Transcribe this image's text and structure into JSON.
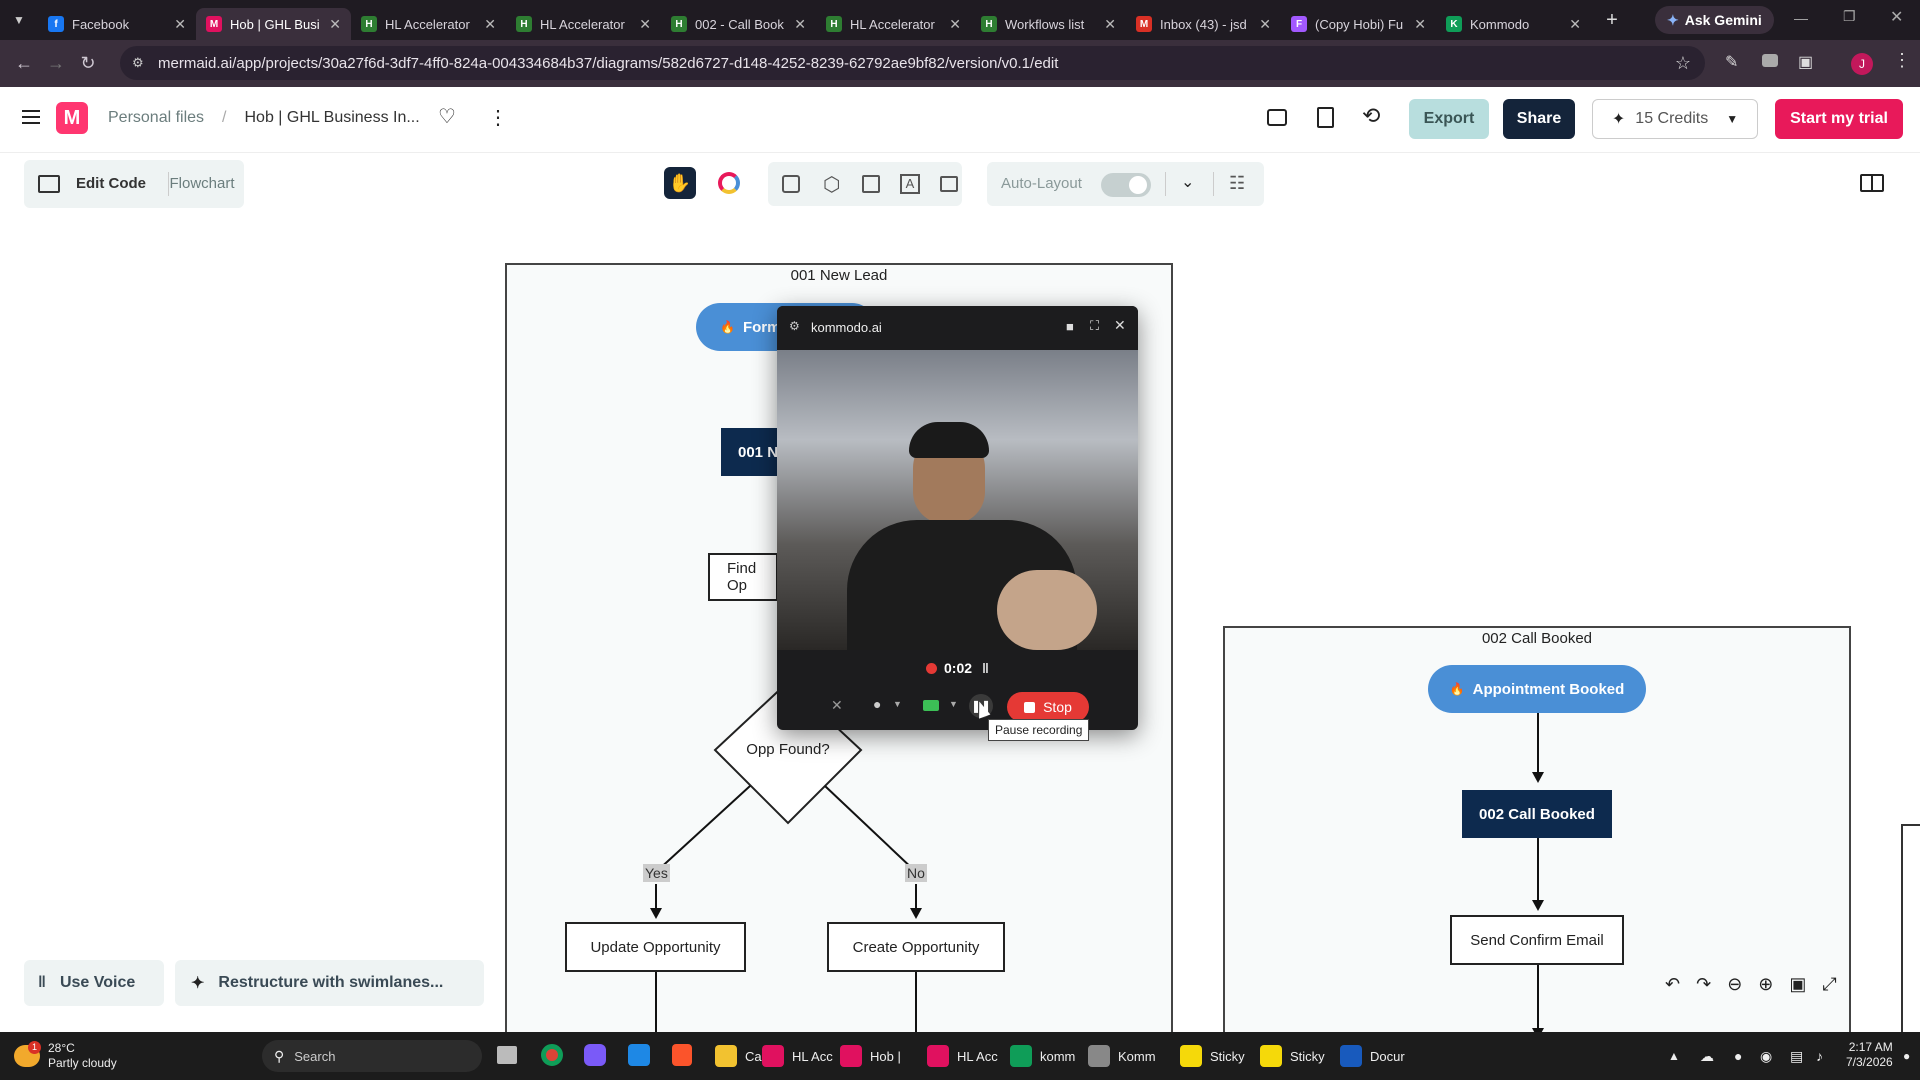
{
  "browser": {
    "tabs": [
      {
        "title": "Facebook",
        "color": "#1877f2",
        "glyph": "f"
      },
      {
        "title": "Hob | GHL Busi",
        "color": "#e0115f",
        "glyph": "M",
        "active": true
      },
      {
        "title": "HL Accelerator",
        "color": "#2e7d32",
        "glyph": "H"
      },
      {
        "title": "HL Accelerator",
        "color": "#2e7d32",
        "glyph": "H"
      },
      {
        "title": "002 - Call Book",
        "color": "#2e7d32",
        "glyph": "H"
      },
      {
        "title": "HL Accelerator",
        "color": "#2e7d32",
        "glyph": "H"
      },
      {
        "title": "Workflows list",
        "color": "#2e7d32",
        "glyph": "H"
      },
      {
        "title": "Inbox (43) - jsd",
        "color": "#d93025",
        "glyph": "M"
      },
      {
        "title": "(Copy Hobi) Fu",
        "color": "#a259ff",
        "glyph": "F"
      },
      {
        "title": "Kommodo",
        "color": "#0f9d58",
        "glyph": "K"
      }
    ],
    "new_tab": "+",
    "gemini": "Ask Gemini",
    "url": "mermaid.ai/app/projects/30a27f6d-3df7-4ff0-824a-004334684b37/diagrams/582d6727-d148-4252-8239-62792ae9bf82/version/v0.1/edit",
    "profile_initial": "J"
  },
  "app": {
    "breadcrumb_root": "Personal files",
    "breadcrumb_sep": "/",
    "doc_title": "Hob | GHL Business In...",
    "export": "Export",
    "share": "Share",
    "credits": "15 Credits",
    "trial": "Start my trial",
    "edit_code": "Edit Code",
    "flowchart": "Flowchart",
    "auto_layout": "Auto-Layout",
    "auto_layout_on": false,
    "use_voice": "Use Voice",
    "restructure": "Restructure with swimlanes..."
  },
  "diagram": {
    "frame1": {
      "title": "001 New Lead",
      "trigger": "Form",
      "stage": "001 N",
      "find": "Find Op",
      "decision": "Opp Found?",
      "yes": "Yes",
      "no": "No",
      "update": "Update Opportunity",
      "create": "Create Opportunity"
    },
    "frame2": {
      "title": "002 Call Booked",
      "trigger": "Appointment Booked",
      "stage": "002 Call Booked",
      "email": "Send Confirm Email"
    }
  },
  "recorder": {
    "site": "kommodo.ai",
    "timer": "0:02",
    "stop": "Stop",
    "tooltip": "Pause recording"
  },
  "taskbar": {
    "temp": "28°C",
    "weather": "Partly cloudy",
    "weather_badge": "1",
    "search": "Search",
    "items": [
      {
        "label": "Captu",
        "color": "#f2c230"
      },
      {
        "label": "HL Acc",
        "color": "#e0115f"
      },
      {
        "label": "Hob |",
        "color": "#e0115f"
      },
      {
        "label": "HL Acc",
        "color": "#e0115f"
      },
      {
        "label": "komm",
        "color": "#0f9d58"
      },
      {
        "label": "Komm",
        "color": "#888"
      },
      {
        "label": "Sticky",
        "color": "#f5d90a"
      },
      {
        "label": "Sticky",
        "color": "#f5d90a"
      },
      {
        "label": "Docur",
        "color": "#185abd"
      }
    ],
    "time": "2:17 AM",
    "date": "7/3/2026"
  }
}
